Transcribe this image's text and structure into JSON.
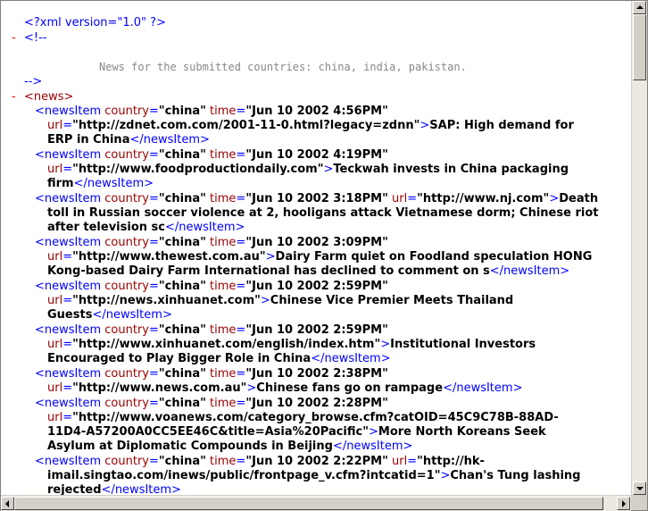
{
  "xml_decl": "<?xml version=\"1.0\" ?>",
  "collapse_glyph": "-",
  "comment_open": "<!--",
  "comment_text": "News for the submitted countries: china, india, pakistan.",
  "comment_close": "-->",
  "root_open": "<news>",
  "items": [
    {
      "country": "china",
      "time": "Jun 10 2002 4:56PM",
      "url": "http://zdnet.com.com/2001-11-0.html?legacy=zdnn",
      "title1": "SAP: High demand for",
      "title2": "ERP in China"
    },
    {
      "country": "china",
      "time": "Jun 10 2002 4:19PM",
      "url": "http://www.foodproductiondaily.com",
      "title1": "Teckwah invests in China packaging",
      "title2": "firm"
    },
    {
      "country": "china",
      "time": "Jun 10 2002 3:18PM",
      "url": "http://www.nj.com",
      "title1": "Death",
      "title2": "toll in Russian soccer violence at 2, hooligans attack Vietnamese dorm; Chinese riot",
      "title3": "after television sc"
    },
    {
      "country": "china",
      "time": "Jun 10 2002 3:09PM",
      "url": "http://www.thewest.com.au",
      "title1": "Dairy Farm quiet on Foodland speculation HONG",
      "title2": "Kong-based Dairy Farm International has declined to comment on s"
    },
    {
      "country": "china",
      "time": "Jun 10 2002 2:59PM",
      "url": "http://news.xinhuanet.com",
      "title1": "Chinese Vice Premier Meets Thailand",
      "title2": "Guests"
    },
    {
      "country": "china",
      "time": "Jun 10 2002 2:59PM",
      "url": "http://www.xinhuanet.com/english/index.htm",
      "title1": "Institutional Investors",
      "title2": "Encouraged to Play Bigger Role in China"
    },
    {
      "country": "china",
      "time": "Jun 10 2002 2:38PM",
      "url": "http://www.news.com.au",
      "title1": "Chinese fans go on rampage"
    },
    {
      "country": "china",
      "time": "Jun 10 2002 2:28PM",
      "url1": "http://www.voanews.com/category_browse.cfm?catOID=45C9C78B-88AD-",
      "url2": "11D4-A57200A0CC5EE46C&title=Asia%20Pacific",
      "title1": "More North Koreans Seek",
      "title2": "Asylum at Diplomatic Compounds in Beijing"
    },
    {
      "country": "china",
      "time": "Jun 10 2002 2:22PM",
      "url1": "http://hk-",
      "url2": "imail.singtao.com/inews/public/frontpage_v.cfm?intcatid=1",
      "title1": "Chan's Tung lashing",
      "title2": "rejected"
    }
  ],
  "tags": {
    "item_open": "<newsItem",
    "item_close": "</newsItem>",
    "attr_country": "country",
    "attr_time": "time",
    "attr_url": "url",
    "eq": "=",
    "quote": "\"",
    "gt": ">"
  }
}
